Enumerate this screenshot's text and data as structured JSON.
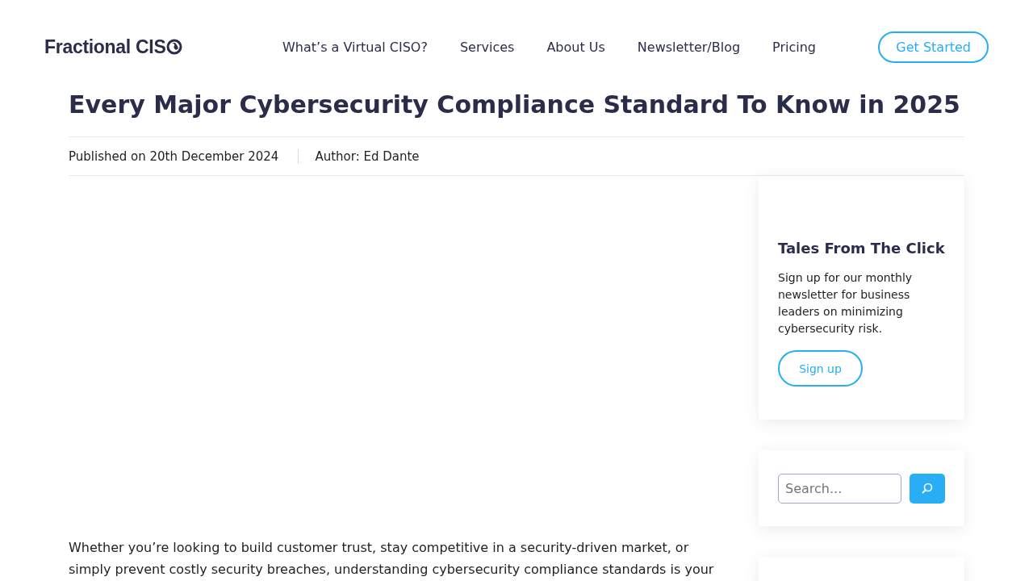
{
  "header": {
    "logo": {
      "text": "Fractional CIS"
    },
    "nav": [
      {
        "label": "What’s a Virtual CISO?"
      },
      {
        "label": "Services"
      },
      {
        "label": "About Us"
      },
      {
        "label": "Newsletter/Blog"
      },
      {
        "label": "Pricing"
      }
    ],
    "cta": "Get Started"
  },
  "article": {
    "title": "Every Major Cybersecurity Compliance Standard To Know in 2025",
    "published": "Published on 20th December 2024",
    "author": "Author: Ed Dante",
    "paragraph": "Whether you’re looking to build customer trust, stay competitive in a security-driven market, or simply prevent costly security breaches, understanding cybersecurity compliance standards is your"
  },
  "sidebar": {
    "newsletter": {
      "title": "Tales From The Click",
      "text": "Sign up for our monthly newsletter for business leaders on minimizing cybersecurity risk.",
      "button": "Sign up"
    },
    "search": {
      "placeholder": "Search..."
    }
  }
}
